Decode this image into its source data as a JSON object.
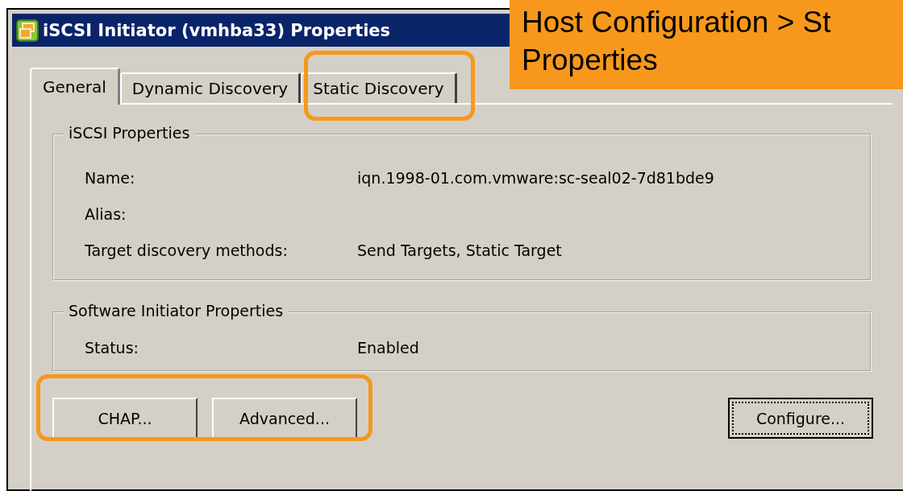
{
  "window": {
    "title": "iSCSI Initiator (vmhba33) Properties"
  },
  "callout": {
    "lines": [
      "Host Configuration > St",
      "Properties"
    ]
  },
  "tabs": [
    {
      "label": "General",
      "selected": true
    },
    {
      "label": "Dynamic Discovery",
      "selected": false
    },
    {
      "label": "Static Discovery",
      "selected": false
    }
  ],
  "groups": [
    {
      "title": "iSCSI Properties",
      "rows": [
        {
          "label": "Name:",
          "value": "iqn.1998-01.com.vmware:sc-seal02-7d81bde9"
        },
        {
          "label": "Alias:"
        },
        {
          "label": "Target discovery methods:",
          "value": "Send Targets, Static Target"
        }
      ]
    },
    {
      "title": "Software Initiator Properties",
      "rows": [
        {
          "label": "Status:",
          "value": "Enabled"
        }
      ]
    }
  ],
  "buttons": [
    {
      "label": "CHAP...",
      "focused": false
    },
    {
      "label": "Advanced...",
      "focused": false
    },
    {
      "label": "Configure...",
      "focused": true
    }
  ]
}
